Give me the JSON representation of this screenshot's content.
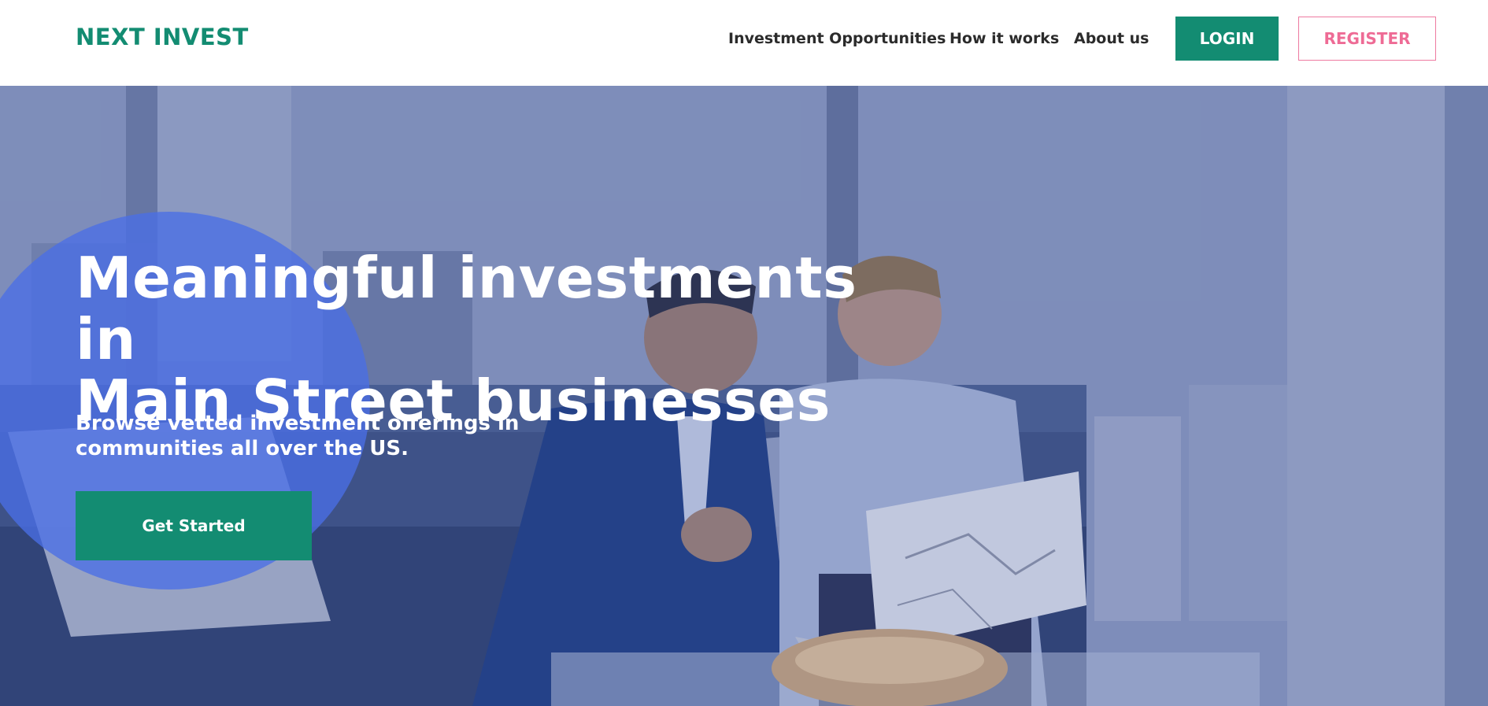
{
  "header": {
    "logo": "NEXT INVEST",
    "nav": [
      {
        "label": "Investment Opportunities"
      },
      {
        "label": "How it works"
      },
      {
        "label": "About us"
      }
    ],
    "login_label": "LOGIN",
    "register_label": "REGISTER"
  },
  "hero": {
    "title_line1": "Meaningful investments in",
    "title_line2": "Main Street businesses",
    "subtitle_line1": "Browse vetted investment offerings in",
    "subtitle_line2": "communities all over the US.",
    "cta_label": "Get Started",
    "image_description_icon": "hero-photo"
  },
  "colors": {
    "brand_green": "#138c72",
    "register_pink": "#ee6b95",
    "hero_blob": "#4a6ee6",
    "hero_tint": "#8090b8"
  }
}
